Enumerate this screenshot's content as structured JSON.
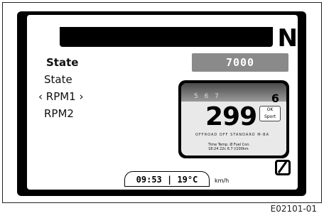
{
  "display": {
    "gear_indicator": "N",
    "menu": {
      "items": [
        {
          "label": "State",
          "style": "bold"
        },
        {
          "label": "State",
          "style": "normal"
        },
        {
          "label": "‹ RPM1 ›",
          "style": "selected"
        },
        {
          "label": "RPM2",
          "style": "normal"
        }
      ]
    },
    "value_box": "7000",
    "preview": {
      "tach_digits": "5 6 7",
      "gear": "6",
      "speed": "299",
      "mode_line1": "OK",
      "mode_line2": "Sport",
      "icons_row": "OFFROAD  OFF  STANDARD  M-BA",
      "info_line1": "Time    Temp.   Ø Fuel Con.",
      "info_line2": "18:24   22c    6.7 l/100km"
    },
    "status": {
      "time_temp": "09:53 | 19°C",
      "unit": "km/h"
    }
  },
  "figure_ref": "E02101-01",
  "colors": {
    "bezel": "#000000",
    "value_box": "#8a8a8a",
    "screen": "#ffffff"
  },
  "icons": {
    "neutral": "neutral-slash-icon"
  }
}
